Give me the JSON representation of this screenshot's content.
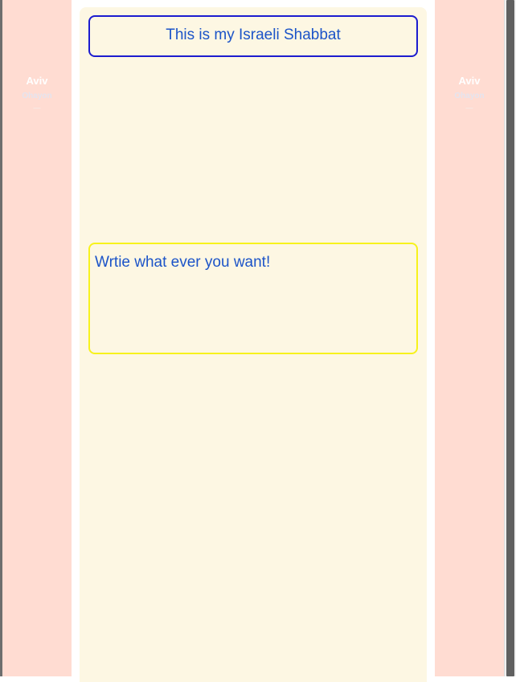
{
  "left_panel": {
    "name": "Aviv",
    "surname": "Ohayon",
    "dash": "—"
  },
  "right_panel": {
    "name": "Aviv",
    "surname": "Ohayon",
    "dash": "—"
  },
  "main": {
    "title": "This is my Israeli Shabbat",
    "write_text": "Wrtie what ever you want!"
  },
  "colors": {
    "side_panel_bg": "#ffdcd2",
    "main_bg": "#fdf7e3",
    "title_border": "#1c1ccf",
    "write_border": "#f7f21c",
    "text_blue": "#1c54c8"
  }
}
